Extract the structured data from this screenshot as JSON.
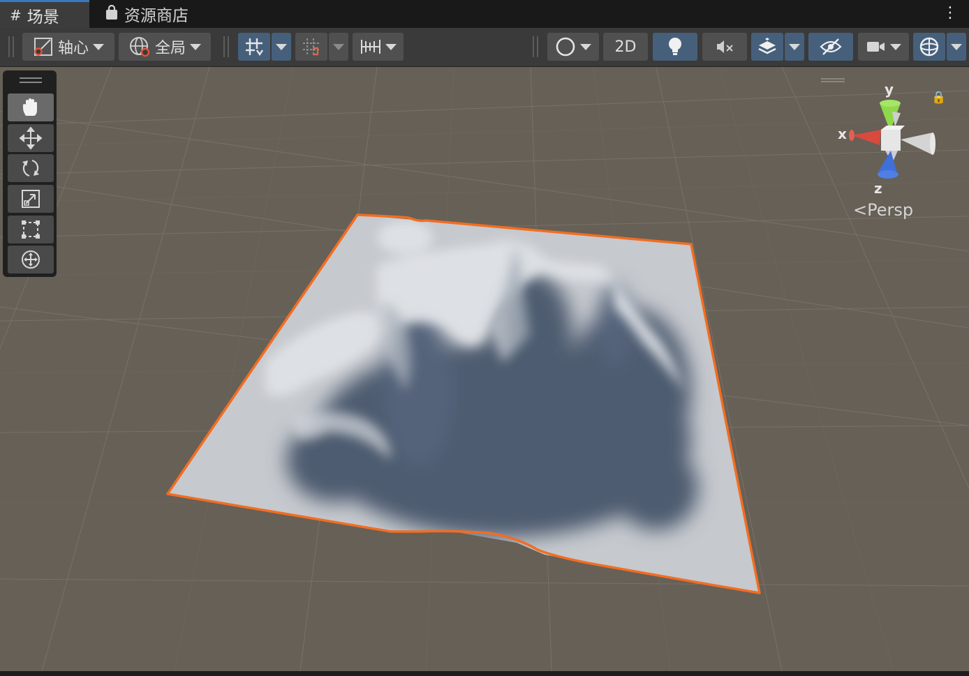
{
  "tabs": [
    {
      "label": "场景",
      "icon": "grid-hash-icon"
    },
    {
      "label": "资源商店",
      "icon": "shopping-bag-icon"
    }
  ],
  "toolbar": {
    "pivot_label": "轴心",
    "space_label": "全局",
    "mode_2d_label": "2D"
  },
  "gizmo": {
    "y": "y",
    "x": "x",
    "z": "z",
    "projection": "<Persp"
  },
  "tools": [
    "hand-tool",
    "move-tool",
    "rotate-tool",
    "scale-tool",
    "rect-tool",
    "transform-tool"
  ],
  "colors": {
    "selection_outline": "#f26d21",
    "terrain_light": "#c2c6cb",
    "terrain_shadow": "#4f5d72",
    "viewport_bg": "#666057",
    "x_axis": "#d84a3d",
    "y_axis": "#8fd84a",
    "z_axis": "#3f6fd8"
  }
}
